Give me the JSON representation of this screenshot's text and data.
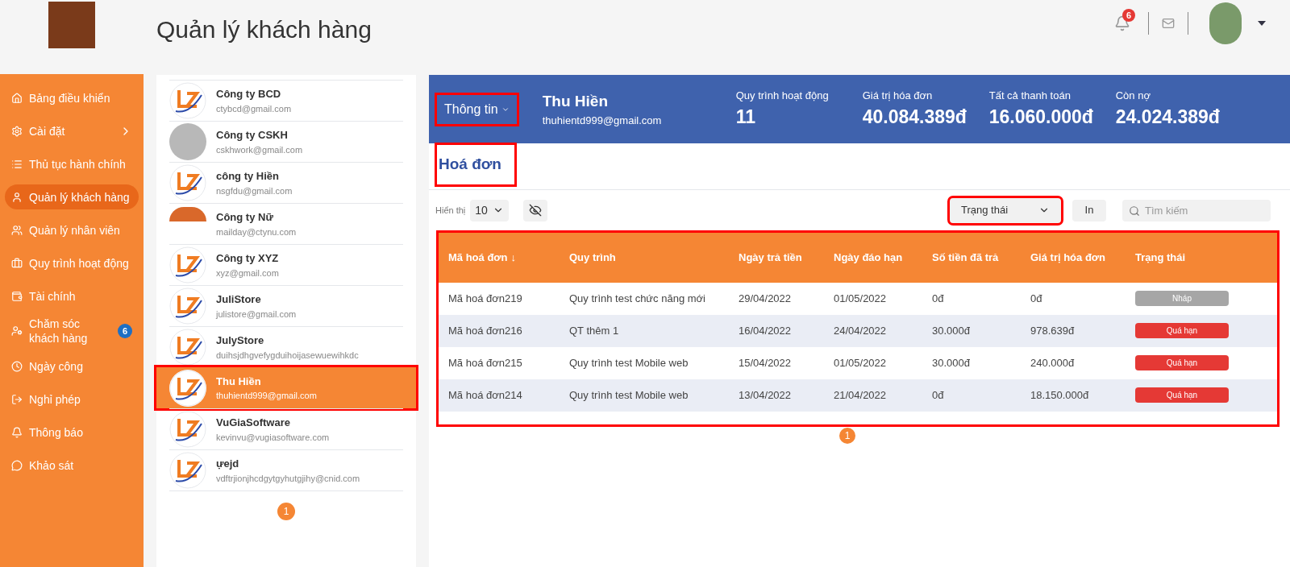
{
  "header": {
    "title": "Quản lý khách hàng",
    "notification_count": "6"
  },
  "sidebar": {
    "items": [
      {
        "label": "Bảng điều khiển",
        "selected": false
      },
      {
        "label": "Cài đặt",
        "selected": false,
        "expandable": true
      },
      {
        "label": "Thủ tục hành chính",
        "selected": false
      },
      {
        "label": "Quản lý khách hàng",
        "selected": true
      },
      {
        "label": "Quản lý nhân viên",
        "selected": false
      },
      {
        "label": "Quy trình hoạt động",
        "selected": false
      },
      {
        "label": "Tài chính",
        "selected": false
      },
      {
        "label": "Chăm sóc khách hàng",
        "selected": false,
        "badge": "6"
      },
      {
        "label": "Ngày công",
        "selected": false
      },
      {
        "label": "Nghỉ phép",
        "selected": false
      },
      {
        "label": "Thông báo",
        "selected": false
      },
      {
        "label": "Khảo sát",
        "selected": false
      }
    ]
  },
  "customers": {
    "items": [
      {
        "name": "Công ty BCD",
        "email": "ctybcd@gmail.com",
        "selected": false,
        "kind": "logo"
      },
      {
        "name": "Công ty CSKH",
        "email": "cskhwork@gmail.com",
        "selected": false,
        "kind": "document"
      },
      {
        "name": "công ty Hiền",
        "email": "nsgfdu@gmail.com",
        "selected": false,
        "kind": "logo"
      },
      {
        "name": "Công ty Nữ",
        "email": "mailday@ctynu.com",
        "selected": false,
        "kind": "banner"
      },
      {
        "name": "Công ty XYZ",
        "email": "xyz@gmail.com",
        "selected": false,
        "kind": "logo"
      },
      {
        "name": "JuliStore",
        "email": "julistore@gmail.com",
        "selected": false,
        "kind": "logo"
      },
      {
        "name": "JulyStore",
        "email": "duihsjdhgvefygduihoijasewuewihkdc",
        "selected": false,
        "kind": "logo"
      },
      {
        "name": "Thu Hiền",
        "email": "thuhientd999@gmail.com",
        "selected": true,
        "highlighted": true,
        "kind": "logo"
      },
      {
        "name": "VuGiaSoftware",
        "email": "kevinvu@vugiasoftware.com",
        "selected": false,
        "kind": "logo"
      },
      {
        "name": "ựejd",
        "email": "vdftrjionjhcdgytgyhutgjihy@cnid.com",
        "selected": false,
        "kind": "logo"
      }
    ],
    "page": "1"
  },
  "profile": {
    "menu_label": "Thông tin",
    "menu_highlighted": true,
    "name": "Thu Hiền",
    "email": "thuhientd999@gmail.com",
    "stats": [
      {
        "label": "Quy trình hoạt động",
        "value": "11"
      },
      {
        "label": "Giá trị hóa đơn",
        "value": "40.084.389đ"
      },
      {
        "label": "Tất cả thanh toán",
        "value": "16.060.000đ"
      },
      {
        "label": "Còn nợ",
        "value": "24.024.389đ"
      }
    ]
  },
  "invoices": {
    "title": "Hoá đơn",
    "title_highlighted": true,
    "show_label": "Hiển thị",
    "page_size": "10",
    "status_filter": "Trạng thái",
    "status_filter_highlighted": true,
    "print_label": "In",
    "search_placeholder": "Tìm kiếm",
    "table_highlighted": true,
    "columns": [
      "Mã hoá đơn",
      "Quy trình",
      "Ngày trả tiền",
      "Ngày đáo hạn",
      "Số tiền đã trả",
      "Giá trị hóa đơn",
      "Trạng thái"
    ],
    "sort_arrow": "↓",
    "rows": [
      {
        "cells": [
          "Mã hoá đơn219",
          "Quy trình test chức năng mới",
          "29/04/2022",
          "01/05/2022",
          "0đ",
          "0đ"
        ],
        "status": {
          "label": "Nháp",
          "kind": "draft"
        }
      },
      {
        "cells": [
          "Mã hoá đơn216",
          "QT thêm 1",
          "16/04/2022",
          "24/04/2022",
          "30.000đ",
          "978.639đ"
        ],
        "status": {
          "label": "Quá hạn",
          "kind": "overdue"
        }
      },
      {
        "cells": [
          "Mã hoá đơn215",
          "Quy trình test Mobile web",
          "15/04/2022",
          "01/05/2022",
          "30.000đ",
          "240.000đ"
        ],
        "status": {
          "label": "Quá hạn",
          "kind": "overdue"
        }
      },
      {
        "cells": [
          "Mã hoá đơn214",
          "Quy trình test Mobile web",
          "13/04/2022",
          "21/04/2022",
          "0đ",
          "18.150.000đ"
        ],
        "status": {
          "label": "Quá hạn",
          "kind": "overdue"
        }
      }
    ],
    "page": "1"
  }
}
